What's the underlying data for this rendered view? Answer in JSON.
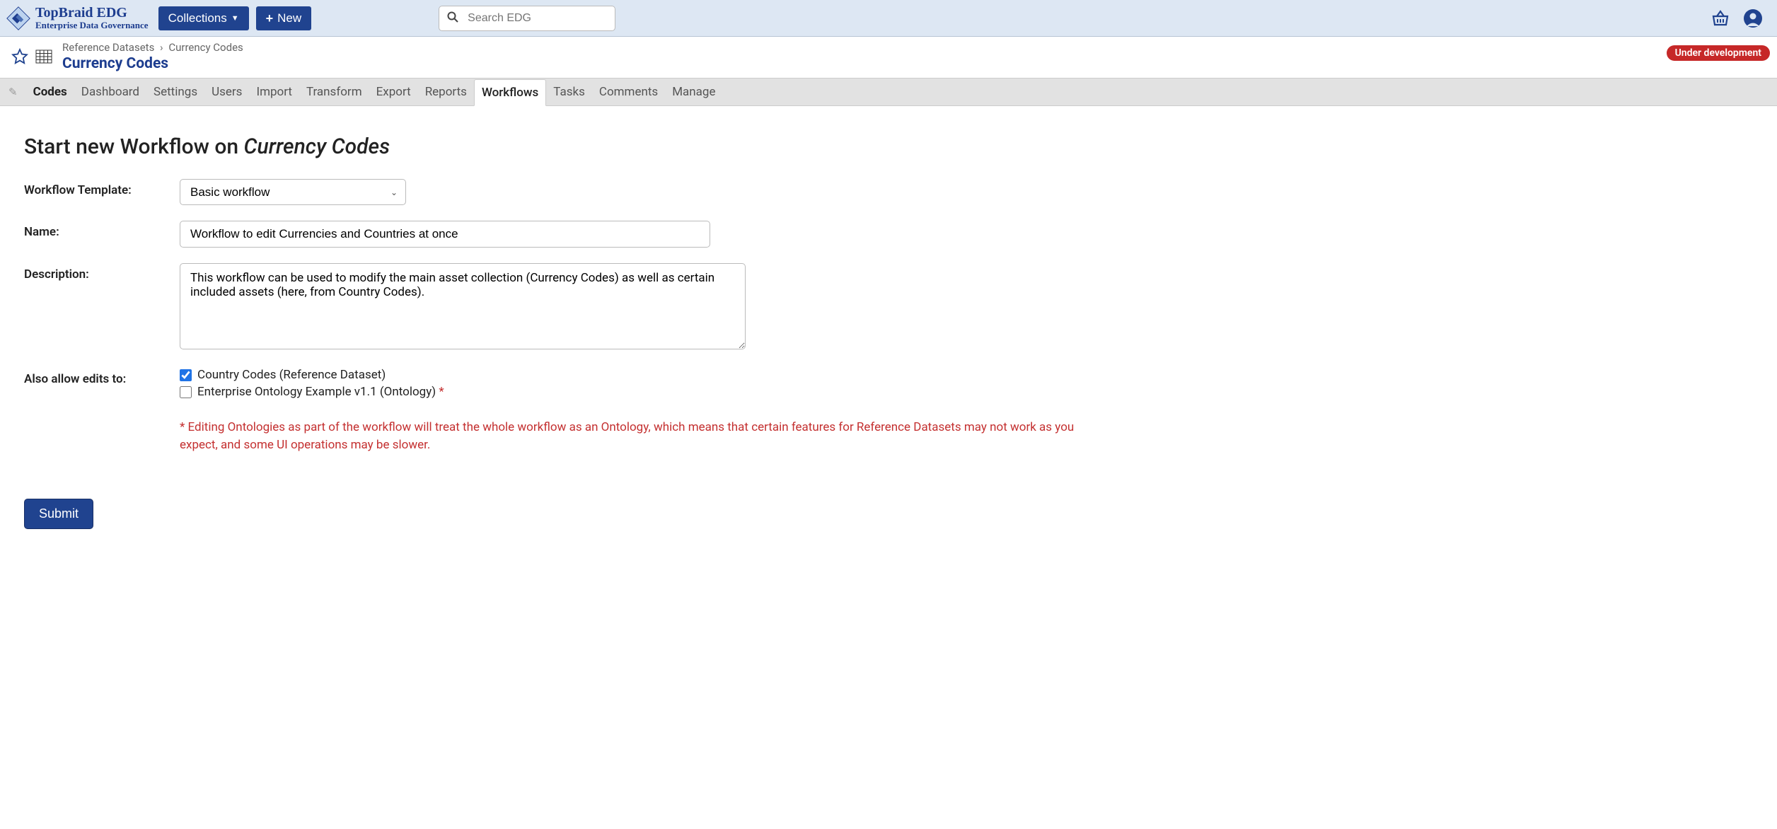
{
  "brand": {
    "title": "TopBraid EDG",
    "subtitle": "Enterprise Data Governance"
  },
  "topbar": {
    "collections_label": "Collections",
    "new_label": "New",
    "search_placeholder": "Search EDG"
  },
  "breadcrumb": {
    "parent": "Reference Datasets",
    "current": "Currency Codes"
  },
  "page": {
    "title": "Currency Codes",
    "status": "Under development"
  },
  "tabs": {
    "codes": "Codes",
    "dashboard": "Dashboard",
    "settings": "Settings",
    "users": "Users",
    "import": "Import",
    "transform": "Transform",
    "export": "Export",
    "reports": "Reports",
    "workflows": "Workflows",
    "tasks": "Tasks",
    "comments": "Comments",
    "manage": "Manage"
  },
  "form": {
    "heading_prefix": "Start new Workflow on ",
    "heading_subject": "Currency Codes",
    "template_label": "Workflow Template:",
    "template_value": "Basic workflow",
    "name_label": "Name:",
    "name_value": "Workflow to edit Currencies and Countries at once",
    "description_label": "Description:",
    "description_value": "This workflow can be used to modify the main asset collection (Currency Codes) as well as certain included assets (here, from Country Codes).",
    "also_allow_label": "Also allow edits to:",
    "option1_label": "Country Codes (Reference Dataset)",
    "option2_label": "Enterprise Ontology Example v1.1 (Ontology) ",
    "option2_star": "*",
    "warning": "* Editing Ontologies as part of the workflow will treat the whole workflow as an Ontology, which means that certain features for Reference Datasets may not work as you expect, and some UI operations may be slower.",
    "submit_label": "Submit"
  }
}
